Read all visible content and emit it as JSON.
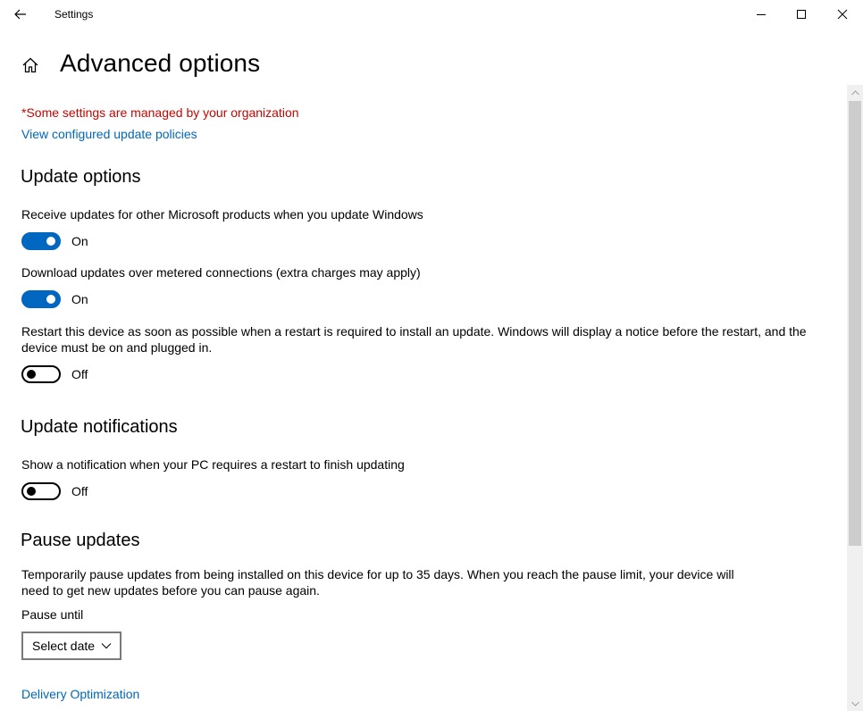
{
  "window": {
    "title": "Settings"
  },
  "header": {
    "title": "Advanced options"
  },
  "managed_note": "*Some settings are managed by your organization",
  "policies_link": "View configured update policies",
  "update_options": {
    "heading": "Update options",
    "settings": [
      {
        "label": "Receive updates for other Microsoft products when you update Windows",
        "state": "On"
      },
      {
        "label": "Download updates over metered connections (extra charges may apply)",
        "state": "On"
      },
      {
        "label_line1": "Restart this device as soon as possible when a restart is required to install an update. Windows will display a notice before the restart, and the",
        "label_line2": "device must be on and plugged in.",
        "state": "Off"
      }
    ]
  },
  "update_notifications": {
    "heading": "Update notifications",
    "setting": {
      "label": "Show a notification when your PC requires a restart to finish updating",
      "state": "Off"
    }
  },
  "pause_updates": {
    "heading": "Pause updates",
    "description_line1": "Temporarily pause updates from being installed on this device for up to 35 days. When you reach the pause limit, your device will",
    "description_line2": "need to get new updates before you can pause again.",
    "pause_until_label": "Pause until",
    "select_value": "Select date"
  },
  "delivery_link": "Delivery Optimization",
  "colors": {
    "accent": "#0067c0",
    "link": "#0067b8",
    "warning": "#c50500"
  },
  "icons": [
    "back-arrow-icon",
    "minimize-icon",
    "maximize-icon",
    "close-icon",
    "home-icon",
    "chevron-down-icon"
  ]
}
